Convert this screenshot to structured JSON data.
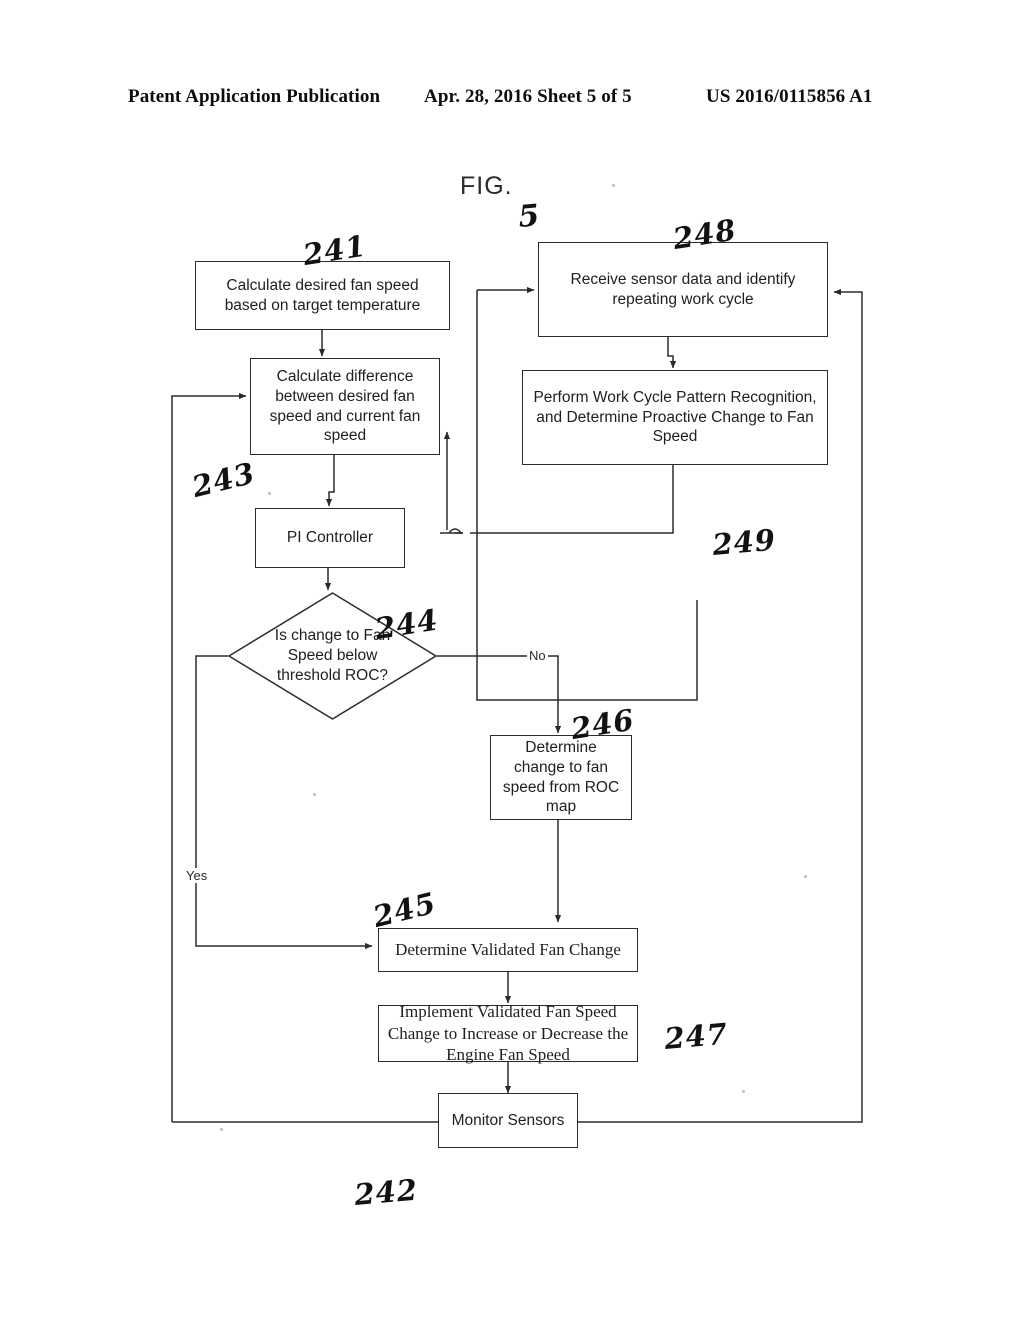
{
  "header": {
    "publication": "Patent Application Publication",
    "date_sheet": "Apr. 28, 2016  Sheet 5 of 5",
    "number": "US 2016/0115856 A1"
  },
  "figure": {
    "title": "FIG. 5",
    "title_text": "FIG.",
    "title_number": "5"
  },
  "nodes": {
    "calc_desired": {
      "id": "241",
      "text": "Calculate desired fan speed based on target temperature"
    },
    "calc_difference": {
      "id": "243",
      "text": "Calculate difference between desired fan speed and current fan speed"
    },
    "pi_controller": {
      "id": "",
      "text": "PI Controller"
    },
    "decision_roc": {
      "id": "244",
      "text": "Is change to Fan Speed below threshold ROC?"
    },
    "receive_sensor": {
      "id": "248",
      "text": "Receive sensor data and identify repeating work cycle"
    },
    "pattern_recognition": {
      "id": "249",
      "text": "Perform Work Cycle Pattern Recognition, and Determine Proactive Change to Fan Speed"
    },
    "roc_map": {
      "id": "246",
      "text": "Determine change to fan speed from ROC map"
    },
    "validated_change": {
      "id": "245",
      "text": "Determine  Validated Fan Change"
    },
    "implement_change": {
      "id": "247",
      "text": "Implement  Validated Fan Speed Change to Increase or Decrease the Engine Fan Speed"
    },
    "monitor_sensors": {
      "id": "242",
      "text": "Monitor Sensors"
    }
  },
  "branches": {
    "yes": "Yes",
    "no": "No"
  }
}
